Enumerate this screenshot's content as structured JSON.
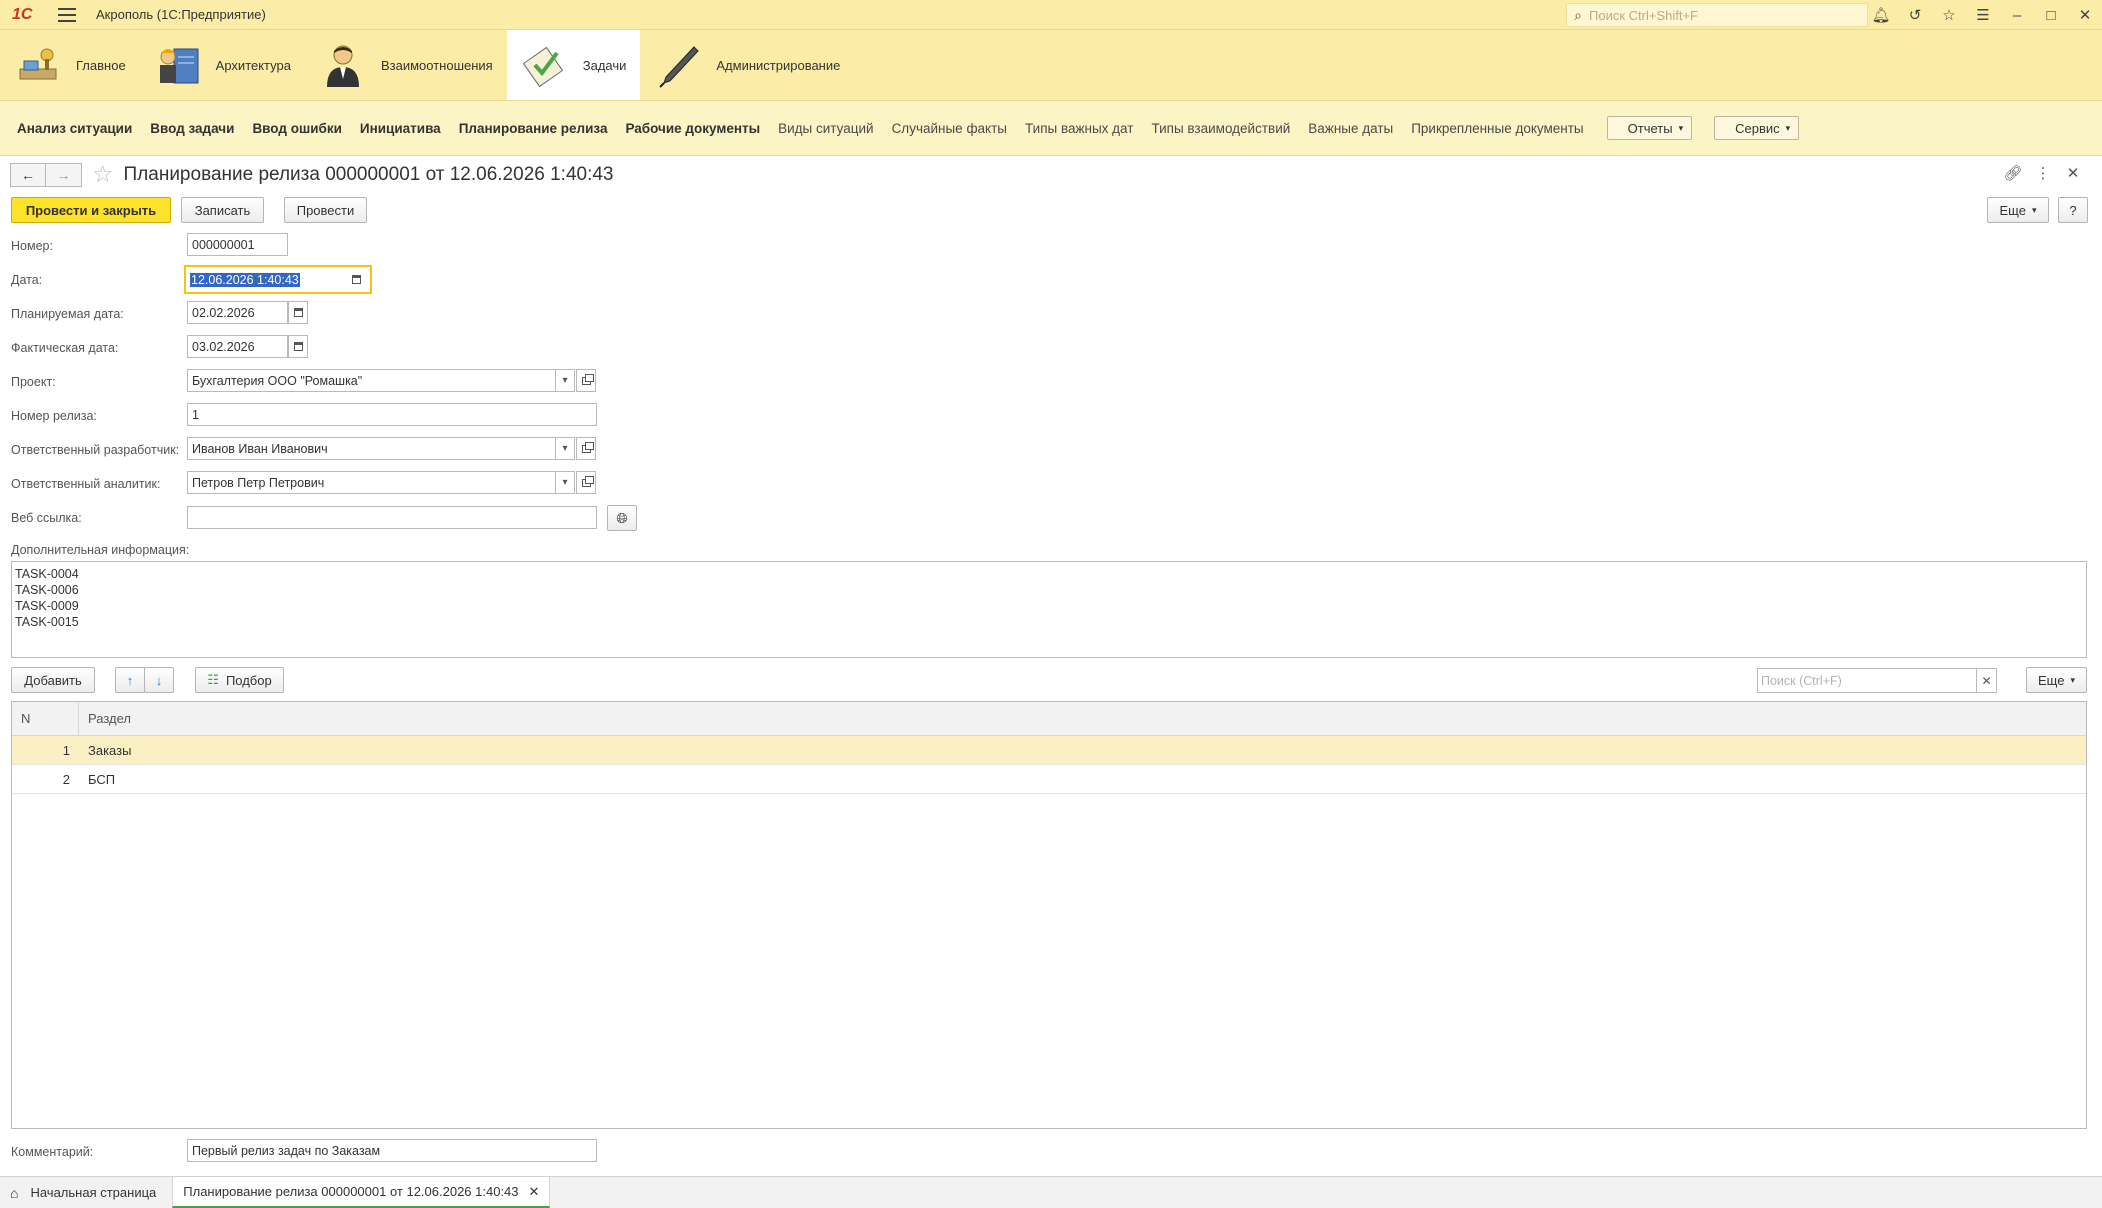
{
  "app": {
    "logo": "1С",
    "title": "Акрополь  (1С:Предприятие)",
    "search_placeholder": "Поиск Ctrl+Shift+F",
    "icons": [
      "bell-icon",
      "history-icon",
      "star-icon",
      "menu-lines-icon",
      "minimize-icon",
      "maximize-icon",
      "close-icon"
    ]
  },
  "sections": [
    {
      "label": "Главное",
      "icon": "home-desk-icon",
      "active": false
    },
    {
      "label": "Архитектура",
      "icon": "architect-icon",
      "active": false
    },
    {
      "label": "Взаимоотношения",
      "icon": "person-icon",
      "active": false
    },
    {
      "label": "Задачи",
      "icon": "task-check-icon",
      "active": true
    },
    {
      "label": "Администрирование",
      "icon": "pen-icon",
      "active": false
    }
  ],
  "nav": {
    "items": [
      {
        "label": "Анализ ситуации",
        "bold": true
      },
      {
        "label": "Ввод задачи",
        "bold": true
      },
      {
        "label": "Ввод ошибки",
        "bold": true
      },
      {
        "label": "Инициатива",
        "bold": true
      },
      {
        "label": "Планирование релиза",
        "bold": true
      },
      {
        "label": "Рабочие документы",
        "bold": true
      },
      {
        "label": "Виды ситуаций",
        "bold": false
      },
      {
        "label": "Случайные факты",
        "bold": false
      },
      {
        "label": "Типы важных дат",
        "bold": false
      },
      {
        "label": "Типы взаимодействий",
        "bold": false
      },
      {
        "label": "Важные даты",
        "bold": false
      },
      {
        "label": "Прикрепленные документы",
        "bold": false
      }
    ],
    "reports": "Отчеты",
    "service": "Сервис"
  },
  "form": {
    "title": "Планирование релиза 000000001 от 12.06.2026 1:40:43",
    "buttons": {
      "post_close": "Провести и закрыть",
      "save": "Записать",
      "post": "Провести",
      "more": "Еще",
      "help": "?"
    },
    "fields": {
      "number": {
        "label": "Номер:",
        "value": "000000001"
      },
      "date": {
        "label": "Дата:",
        "value": "12.06.2026  1:40:43"
      },
      "planned_date": {
        "label": "Планируемая дата:",
        "value": "02.02.2026"
      },
      "actual_date": {
        "label": "Фактическая дата:",
        "value": "03.02.2026"
      },
      "project": {
        "label": "Проект:",
        "value": "Бухгалтерия ООО \"Ромашка\""
      },
      "release_number": {
        "label": "Номер релиза:",
        "value": "1"
      },
      "developer": {
        "label": "Ответственный разработчик:",
        "value": "Иванов Иван Иванович"
      },
      "analyst": {
        "label": "Ответственный аналитик:",
        "value": "Петров Петр Петрович"
      },
      "web_link": {
        "label": "Веб ссылка:",
        "value": ""
      },
      "extra_info": {
        "label": "Дополнительная информация:",
        "lines": [
          "TASK-0004",
          "TASK-0006",
          "TASK-0009",
          "TASK-0015"
        ]
      },
      "comment": {
        "label": "Комментарий:",
        "value": "Первый релиз задач по Заказам"
      }
    },
    "table": {
      "add": "Добавить",
      "pick": "Подбор",
      "search_placeholder": "Поиск (Ctrl+F)",
      "more": "Еще",
      "columns": [
        "N",
        "Раздел"
      ],
      "rows": [
        {
          "n": "1",
          "section": "Заказы"
        },
        {
          "n": "2",
          "section": "БСП"
        }
      ]
    }
  },
  "bottom_tabs": {
    "home": "Начальная страница",
    "current": "Планирование релиза 000000001 от 12.06.2026 1:40:43"
  }
}
